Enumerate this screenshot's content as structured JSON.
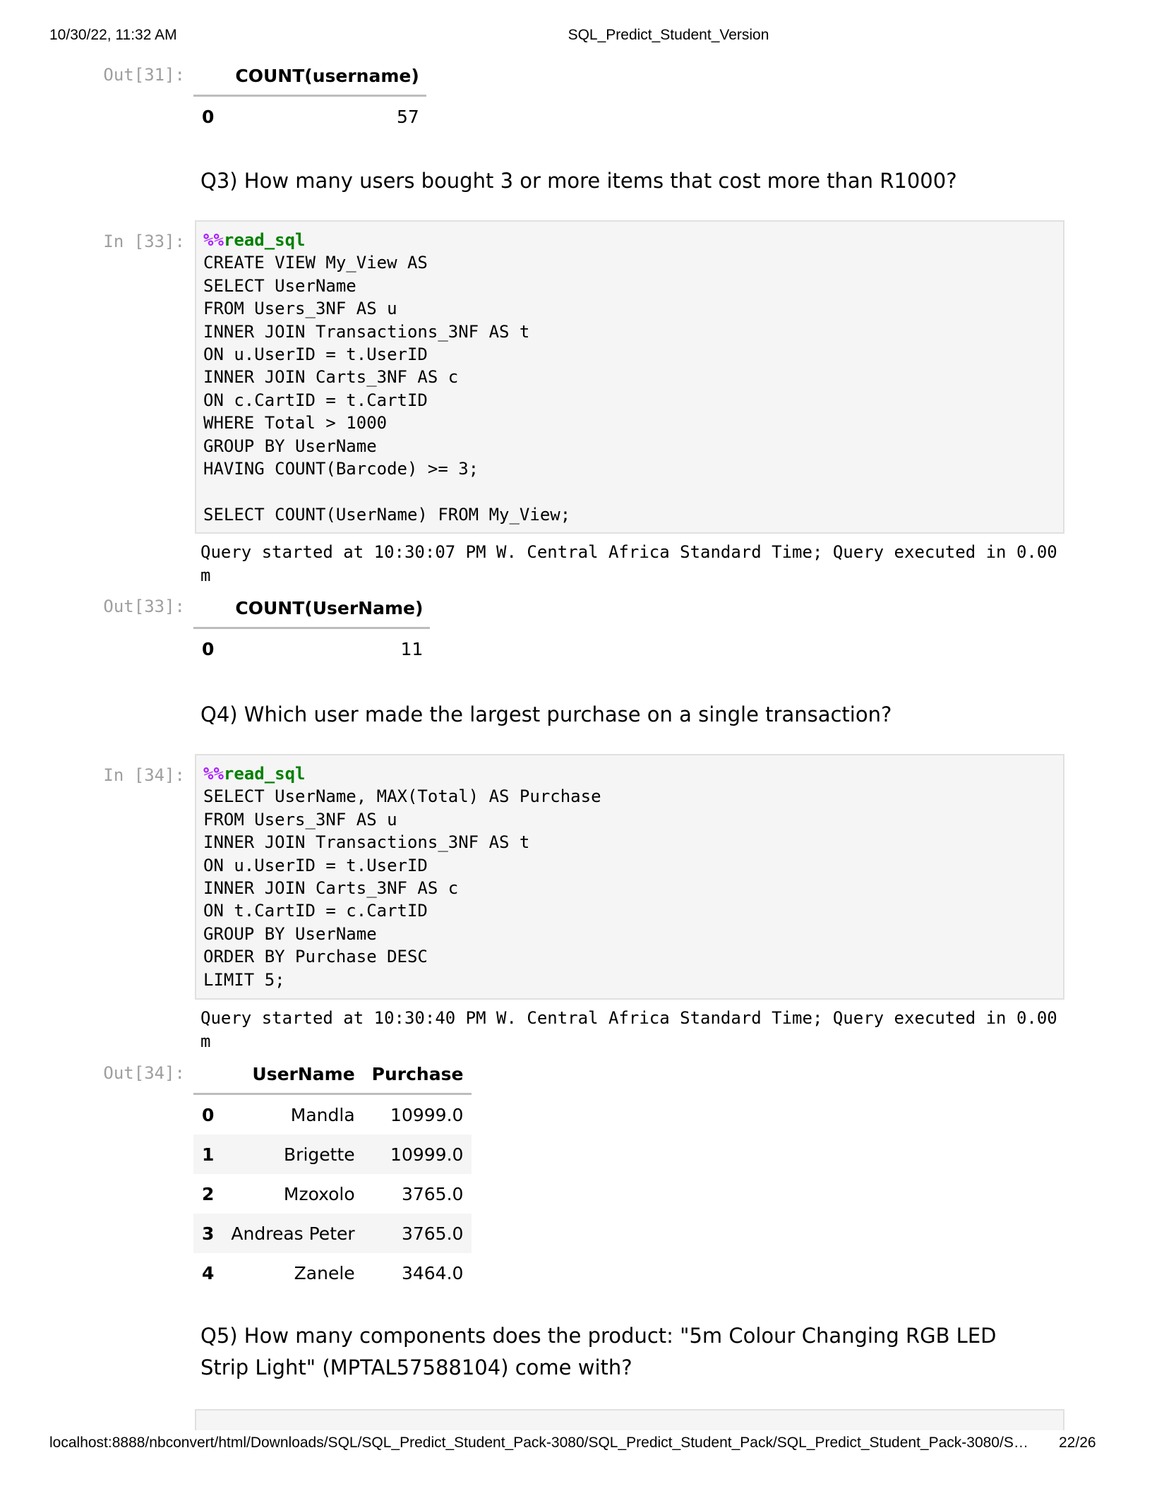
{
  "print_header": {
    "datetime": "10/30/22, 11:32 AM",
    "title": "SQL_Predict_Student_Version"
  },
  "print_footer": {
    "url": "localhost:8888/nbconvert/html/Downloads/SQL/SQL_Predict_Student_Pack-3080/SQL_Predict_Student_Pack/SQL_Predict_Student_Pack-3080/S…",
    "page": "22/26"
  },
  "cells": {
    "out31": {
      "prompt": "Out[31]:",
      "columns": [
        "COUNT(username)"
      ],
      "rows": [
        {
          "index": "0",
          "values": [
            "57"
          ]
        }
      ]
    },
    "q3": {
      "text": "Q3) How many users bought 3 or more items that cost more than R1000?"
    },
    "in33": {
      "prompt": "In [33]:",
      "magic_pct": "%%",
      "magic_name": "read_sql",
      "code": "CREATE VIEW My_View AS\nSELECT UserName\nFROM Users_3NF AS u\nINNER JOIN Transactions_3NF AS t\nON u.UserID = t.UserID\nINNER JOIN Carts_3NF AS c\nON c.CartID = t.CartID\nWHERE Total > 1000\nGROUP BY UserName\nHAVING COUNT(Barcode) >= 3;\n\nSELECT COUNT(UserName) FROM My_View;",
      "stdout": "Query started at 10:30:07 PM W. Central Africa Standard Time; Query executed in 0.00 m"
    },
    "out33": {
      "prompt": "Out[33]:",
      "columns": [
        "COUNT(UserName)"
      ],
      "rows": [
        {
          "index": "0",
          "values": [
            "11"
          ]
        }
      ]
    },
    "q4": {
      "text": "Q4) Which user made the largest purchase on a single transaction?"
    },
    "in34": {
      "prompt": "In [34]:",
      "magic_pct": "%%",
      "magic_name": "read_sql",
      "code": "SELECT UserName, MAX(Total) AS Purchase\nFROM Users_3NF AS u\nINNER JOIN Transactions_3NF AS t\nON u.UserID = t.UserID\nINNER JOIN Carts_3NF AS c\nON t.CartID = c.CartID\nGROUP BY UserName\nORDER BY Purchase DESC\nLIMIT 5;",
      "stdout": "Query started at 10:30:40 PM W. Central Africa Standard Time; Query executed in 0.00 m"
    },
    "out34": {
      "prompt": "Out[34]:",
      "columns": [
        "UserName",
        "Purchase"
      ],
      "rows": [
        {
          "index": "0",
          "values": [
            "Mandla",
            "10999.0"
          ]
        },
        {
          "index": "1",
          "values": [
            "Brigette",
            "10999.0"
          ]
        },
        {
          "index": "2",
          "values": [
            "Mzoxolo",
            "3765.0"
          ]
        },
        {
          "index": "3",
          "values": [
            "Andreas Peter",
            "3765.0"
          ]
        },
        {
          "index": "4",
          "values": [
            "Zanele",
            "3464.0"
          ]
        }
      ]
    },
    "q5": {
      "text": "Q5) How many components does the product: \"5m Colour Changing RGB LED Strip Light\" (MPTAL57588104) come with?"
    }
  }
}
